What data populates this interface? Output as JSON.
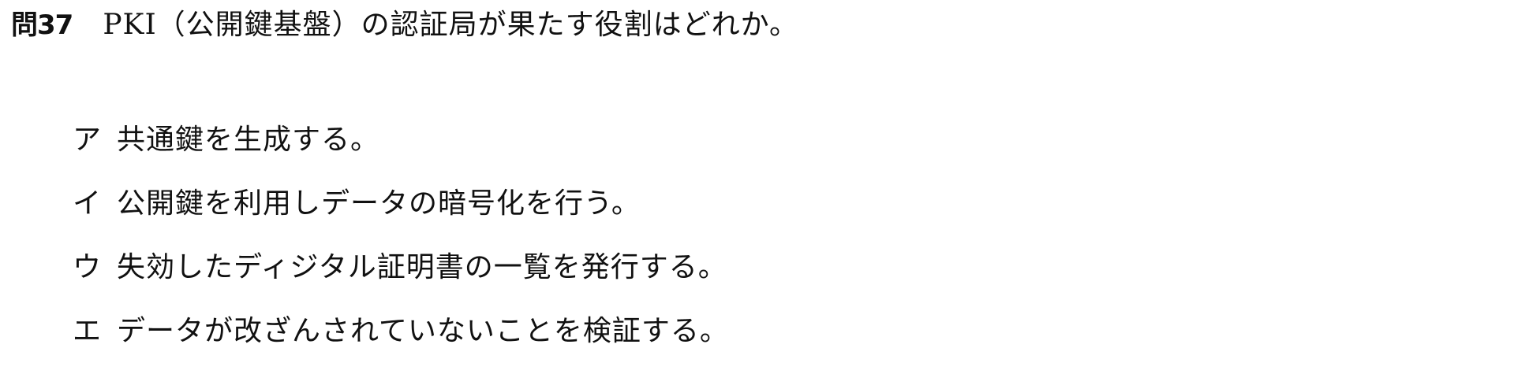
{
  "question": {
    "number": "問37",
    "text": "PKI（公開鍵基盤）の認証局が果たす役割はどれか。"
  },
  "choices": [
    {
      "label": "ア",
      "text": "共通鍵を生成する。"
    },
    {
      "label": "イ",
      "text": "公開鍵を利用しデータの暗号化を行う。"
    },
    {
      "label": "ウ",
      "text": "失効したディジタル証明書の一覧を発行する。"
    },
    {
      "label": "エ",
      "text": "データが改ざんされていないことを検証する。"
    }
  ]
}
